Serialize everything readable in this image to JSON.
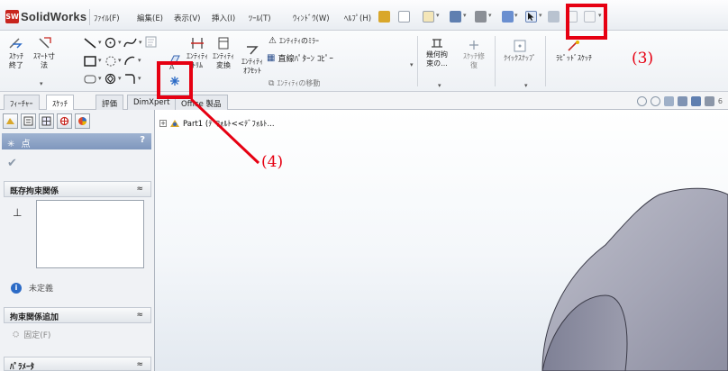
{
  "app": {
    "logo_mark": "SW",
    "name": "SolidWorks"
  },
  "menu": {
    "items": [
      "ﾌｧｲﾙ(F)",
      "編集(E)",
      "表示(V)",
      "挿入(I)",
      "ﾂｰﾙ(T)",
      "ｳｨﾝﾄﾞｳ(W)",
      "ﾍﾙﾌﾟ(H)"
    ]
  },
  "ribbon": {
    "sketch_exit_label": "ｽｹｯﾁ\n終了",
    "smart_dimension_label": "ｽﾏｰﾄ寸\n法",
    "trim_label": "ｴﾝﾃｨﾃｨ\nﾄﾘﾑ",
    "convert_label": "ｴﾝﾃｨﾃｨ\n変換",
    "offset_label": "ｴﾝﾃｨﾃｨ\nｵﾌｾｯﾄ",
    "mirror_label": "ｴﾝﾃｨﾃｨのﾐﾗｰ",
    "linear_pattern_label": "直線ﾊﾟﾀｰﾝ ｺﾋﾟｰ",
    "move_label": "ｴﾝﾃｨﾃｨの移動",
    "relations_label": "幾何拘\n束の...",
    "repair_label": "ｽｹｯﾁ修\n復",
    "quick_snaps_label": "ｸｲｯｸｽﾅｯﾌﾟ",
    "rapid_sketch_label": "ﾗﾋﾟｯﾄﾞｽｹｯﾁ"
  },
  "tabs": [
    "ﾌｨｰﾁｬｰ",
    "ｽｹｯﾁ",
    "評価",
    "DimXpert",
    "Office 製品"
  ],
  "active_tab_index": 1,
  "property_manager": {
    "title": "点",
    "help": "?",
    "existing_relations_header": "既存拘束関係",
    "status_text": "未定義",
    "add_relations_header": "拘束関係追加",
    "fix_label": "固定(F)",
    "parameters_header": "ﾊﾟﾗﾒｰﾀ"
  },
  "graphics": {
    "tree_label": "Part1  (ﾃﾞﾌｫﾙﾄ<<ﾃﾞﾌｫﾙﾄ..."
  },
  "annotations": {
    "label_3": "(3)",
    "label_4": "(4)",
    "color": "#e60012"
  },
  "colors": {
    "pm_header": "#8ea5c8",
    "part_face": "#a9aab8"
  }
}
